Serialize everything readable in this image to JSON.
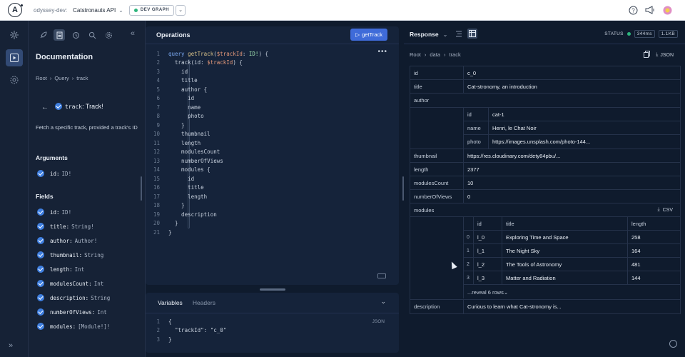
{
  "topbar": {
    "org": "odyssey-dev:",
    "graph": "Catstronauts API",
    "variant": "DEV GRAPH"
  },
  "docs": {
    "title": "Documentation",
    "breadcrumbs": [
      "Root",
      "Query",
      "track"
    ],
    "field_name": "track",
    "field_type": ": Track!",
    "description": "Fetch a specific track, provided a track's ID",
    "arguments_label": "Arguments",
    "arguments": [
      {
        "name": "id:",
        "type": "ID!"
      }
    ],
    "fields_label": "Fields",
    "fields": [
      {
        "name": "id:",
        "type": "ID!"
      },
      {
        "name": "title:",
        "type": "String!"
      },
      {
        "name": "author:",
        "type": "Author!"
      },
      {
        "name": "thumbnail:",
        "type": "String"
      },
      {
        "name": "length:",
        "type": "Int"
      },
      {
        "name": "modulesCount:",
        "type": "Int"
      },
      {
        "name": "description:",
        "type": "String"
      },
      {
        "name": "numberOfViews:",
        "type": "Int"
      },
      {
        "name": "modules:",
        "type": "[Module!]!"
      }
    ]
  },
  "operations": {
    "title": "Operations",
    "run_label": "getTrack",
    "lines": [
      [
        {
          "t": "query ",
          "c": "kw"
        },
        {
          "t": "getTrack",
          "c": "fn"
        },
        {
          "t": "(",
          "c": "plain"
        },
        {
          "t": "$trackId",
          "c": "var"
        },
        {
          "t": ": ",
          "c": "plain"
        },
        {
          "t": "ID!",
          "c": "ty2"
        },
        {
          "t": ") {",
          "c": "plain"
        }
      ],
      [
        {
          "t": "  track(id: ",
          "c": "plain"
        },
        {
          "t": "$trackId",
          "c": "var"
        },
        {
          "t": ") {",
          "c": "plain"
        }
      ],
      [
        {
          "t": "    id",
          "c": "plain"
        }
      ],
      [
        {
          "t": "    title",
          "c": "plain"
        }
      ],
      [
        {
          "t": "    author {",
          "c": "plain"
        }
      ],
      [
        {
          "t": "      id",
          "c": "plain"
        }
      ],
      [
        {
          "t": "      name",
          "c": "plain"
        }
      ],
      [
        {
          "t": "      photo",
          "c": "plain"
        }
      ],
      [
        {
          "t": "    }",
          "c": "plain"
        }
      ],
      [
        {
          "t": "    thumbnail",
          "c": "plain"
        }
      ],
      [
        {
          "t": "    length",
          "c": "plain"
        }
      ],
      [
        {
          "t": "    modulesCount",
          "c": "plain"
        }
      ],
      [
        {
          "t": "    numberOfViews",
          "c": "plain"
        }
      ],
      [
        {
          "t": "    modules {",
          "c": "plain"
        }
      ],
      [
        {
          "t": "      id",
          "c": "plain"
        }
      ],
      [
        {
          "t": "      title",
          "c": "plain"
        }
      ],
      [
        {
          "t": "      length",
          "c": "plain"
        }
      ],
      [
        {
          "t": "    }",
          "c": "plain"
        }
      ],
      [
        {
          "t": "    description",
          "c": "plain"
        }
      ],
      [
        {
          "t": "  }",
          "c": "plain"
        }
      ],
      [
        {
          "t": "}",
          "c": "plain"
        }
      ]
    ]
  },
  "variables": {
    "tab_variables": "Variables",
    "tab_headers": "Headers",
    "json_label": "JSON",
    "lines": [
      [
        {
          "t": "{",
          "c": "plain"
        }
      ],
      [
        {
          "t": "  \"trackId\": ",
          "c": "plain"
        },
        {
          "t": "\"c_0\"",
          "c": "plain"
        }
      ],
      [
        {
          "t": "}",
          "c": "plain"
        }
      ]
    ]
  },
  "response": {
    "title": "Response",
    "status_label": "STATUS",
    "time": "344ms",
    "size": "1.1KB",
    "breadcrumbs": [
      "Root",
      "data",
      "track"
    ],
    "json_label": "JSON",
    "csv_label": "CSV",
    "rows": {
      "id": {
        "k": "id",
        "v": "c_0"
      },
      "title": {
        "k": "title",
        "v": "Cat-stronomy, an introduction"
      },
      "author": {
        "k": "author"
      },
      "thumbnail": {
        "k": "thumbnail",
        "v": "https://res.cloudinary.com/dety84pbu/..."
      },
      "length": {
        "k": "length",
        "v": "2377"
      },
      "modulesCount": {
        "k": "modulesCount",
        "v": "10"
      },
      "numberOfViews": {
        "k": "numberOfViews",
        "v": "0"
      },
      "modules": {
        "k": "modules"
      },
      "description": {
        "k": "description",
        "v": "Curious to learn what Cat-stronomy is..."
      }
    },
    "author_rows": [
      {
        "k": "id",
        "v": "cat-1"
      },
      {
        "k": "name",
        "v": "Henri, le Chat Noir"
      },
      {
        "k": "photo",
        "v": "https://images.unsplash.com/photo-144..."
      }
    ],
    "module_headers": [
      "id",
      "title",
      "length"
    ],
    "modules": [
      {
        "i": "0",
        "id": "l_0",
        "title": "Exploring Time and Space",
        "length": "258"
      },
      {
        "i": "1",
        "id": "l_1",
        "title": "The Night Sky",
        "length": "164"
      },
      {
        "i": "2",
        "id": "l_2",
        "title": "The Tools of Astronomy",
        "length": "481"
      },
      {
        "i": "3",
        "id": "l_3",
        "title": "Matter and Radiation",
        "length": "144"
      }
    ],
    "reveal_label": "...reveal 6 rows"
  }
}
